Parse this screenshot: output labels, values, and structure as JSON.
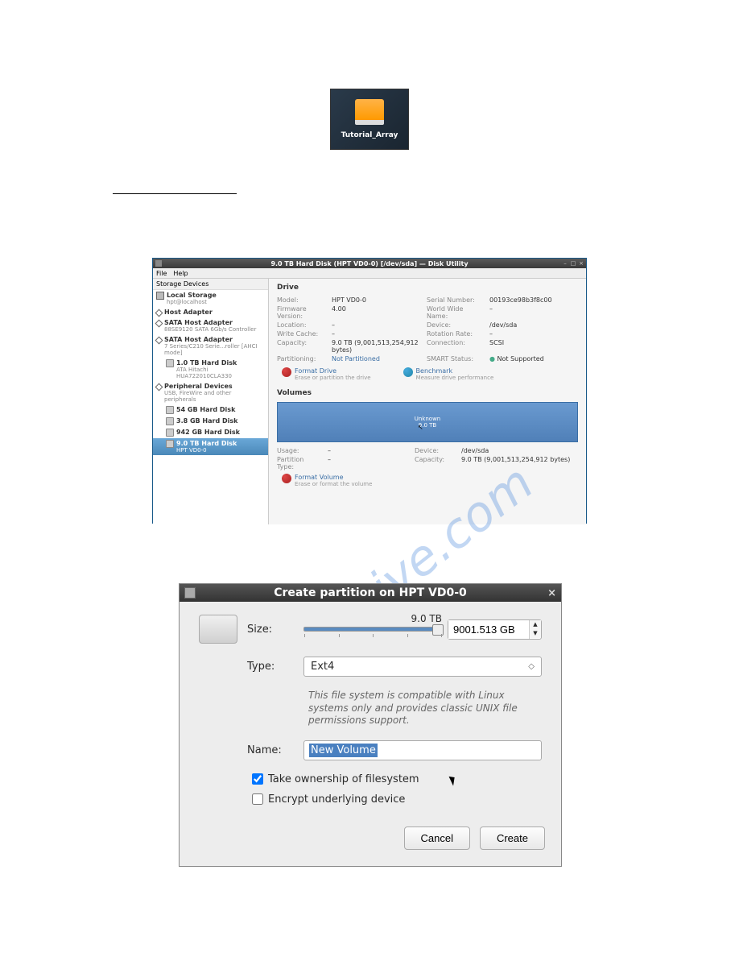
{
  "desktop_icon": {
    "label": "Tutorial_Array"
  },
  "du": {
    "title": "9.0 TB Hard Disk (HPT VD0-0) [/dev/sda] — Disk Utility",
    "menu": {
      "file": "File",
      "help": "Help"
    },
    "sidebar": {
      "header": "Storage Devices",
      "items": [
        {
          "name": "Local Storage",
          "sub": "hpt@localhost"
        },
        {
          "name": "Host Adapter",
          "sub": ""
        },
        {
          "name": "SATA Host Adapter",
          "sub": "88SE9120 SATA 6Gb/s Controller"
        },
        {
          "name": "SATA Host Adapter",
          "sub": "7 Series/C210 Serie...roller [AHCI mode]"
        },
        {
          "name": "1.0 TB Hard Disk",
          "sub": "ATA Hitachi HUA722010CLA330"
        },
        {
          "name": "Peripheral Devices",
          "sub": "USB, FireWire and other peripherals"
        },
        {
          "name": "54 GB Hard Disk",
          "sub": ""
        },
        {
          "name": "3.8 GB Hard Disk",
          "sub": ""
        },
        {
          "name": "942 GB Hard Disk",
          "sub": ""
        },
        {
          "name": "9.0 TB Hard Disk",
          "sub": "HPT VD0-0"
        }
      ]
    },
    "drive": {
      "section": "Drive",
      "rows": [
        [
          "Model:",
          "HPT VD0-0",
          "Serial Number:",
          "00193ce98b3f8c00"
        ],
        [
          "Firmware Version:",
          "4.00",
          "World Wide Name:",
          "–"
        ],
        [
          "Location:",
          "–",
          "Device:",
          "/dev/sda"
        ],
        [
          "Write Cache:",
          "–",
          "Rotation Rate:",
          "–"
        ],
        [
          "Capacity:",
          "9.0 TB (9,001,513,254,912 bytes)",
          "Connection:",
          "SCSI"
        ],
        [
          "Partitioning:",
          "Not Partitioned",
          "SMART Status:",
          "Not Supported"
        ]
      ],
      "actions": {
        "format": {
          "title": "Format Drive",
          "sub": "Erase or partition the drive"
        },
        "benchmark": {
          "title": "Benchmark",
          "sub": "Measure drive performance"
        }
      }
    },
    "volumes": {
      "section": "Volumes",
      "bar": {
        "name": "Unknown",
        "size": "9.0 TB"
      },
      "rows": [
        [
          "Usage:",
          "–",
          "Device:",
          "/dev/sda"
        ],
        [
          "Partition Type:",
          "–",
          "Capacity:",
          "9.0 TB (9,001,513,254,912 bytes)"
        ]
      ],
      "action": {
        "title": "Format Volume",
        "sub": "Erase or format the volume"
      }
    }
  },
  "cp": {
    "title": "Create partition on HPT VD0-0",
    "size_label": "Size:",
    "size_max": "9.0 TB",
    "size_value": "9001.513 GB",
    "type_label": "Type:",
    "type_value": "Ext4",
    "type_hint": "This file system is compatible with Linux systems only and provides classic UNIX file permissions support.",
    "name_label": "Name:",
    "name_value": "New Volume",
    "check_ownership": "Take ownership of filesystem",
    "check_encrypt": "Encrypt underlying device",
    "btn_cancel": "Cancel",
    "btn_create": "Create"
  }
}
